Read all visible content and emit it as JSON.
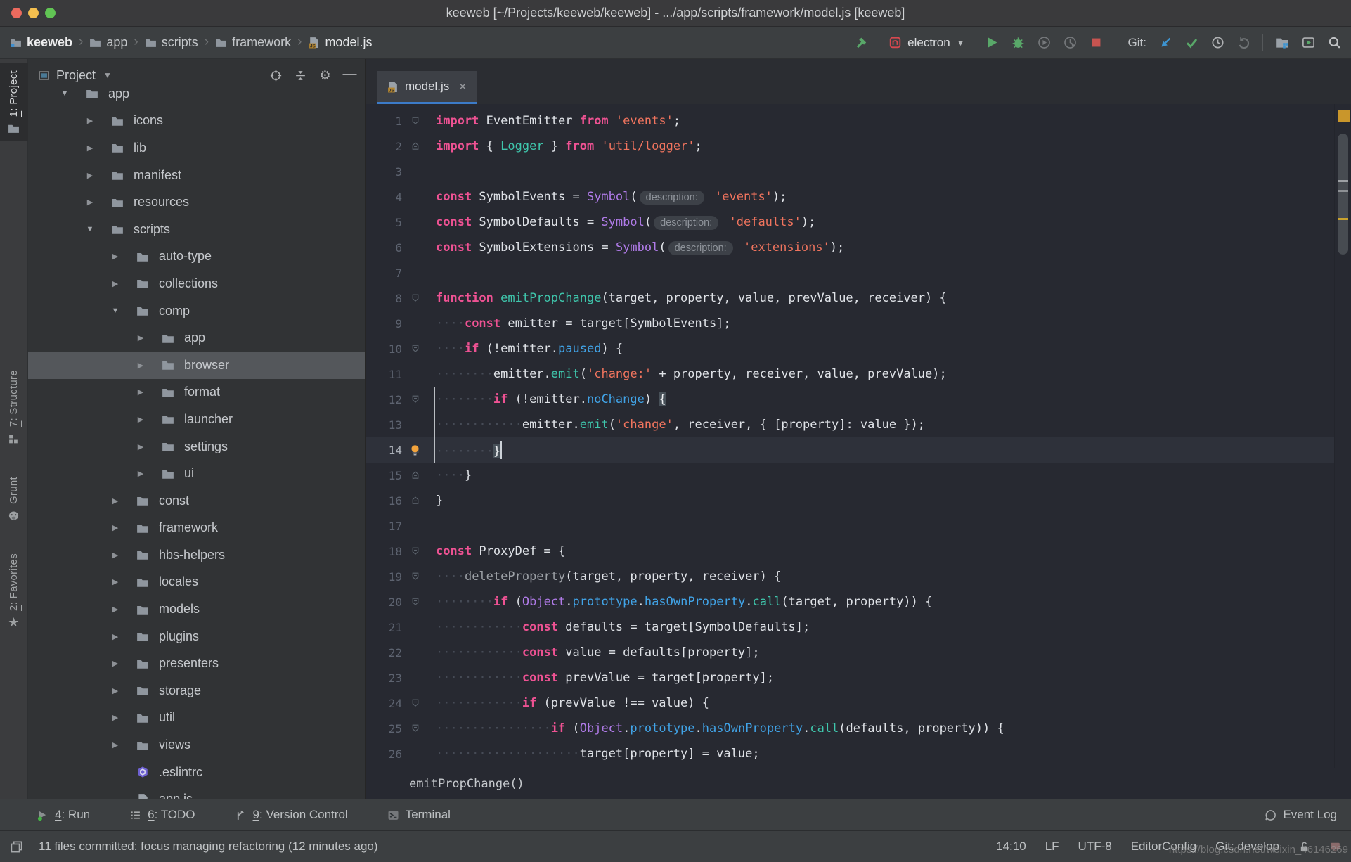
{
  "window": {
    "title": "keeweb [~/Projects/keeweb/keeweb] - .../app/scripts/framework/model.js [keeweb]"
  },
  "breadcrumbs": {
    "items": [
      {
        "label": "keeweb",
        "icon": "project-folder"
      },
      {
        "label": "app",
        "icon": "folder"
      },
      {
        "label": "scripts",
        "icon": "folder"
      },
      {
        "label": "framework",
        "icon": "folder"
      },
      {
        "label": "model.js",
        "icon": "js-file"
      }
    ]
  },
  "toolbar": {
    "run_config": "electron",
    "git_label": "Git:"
  },
  "tool_stripe": {
    "items": [
      {
        "mnemonic": "1",
        "rest": ": Project",
        "icon": "folder",
        "active": true
      },
      {
        "mnemonic": "7",
        "rest": ": Structure",
        "icon": "structure",
        "active": false
      },
      {
        "mnemonic": "",
        "rest": "Grunt",
        "icon": "grunt",
        "active": false
      },
      {
        "mnemonic": "2",
        "rest": ": Favorites",
        "icon": "star",
        "active": false
      }
    ]
  },
  "project_panel": {
    "title": "Project",
    "tree": [
      {
        "label": "app",
        "level": 1,
        "icon": "folder",
        "arrow": "open"
      },
      {
        "label": "icons",
        "level": 2,
        "icon": "folder",
        "arrow": "closed"
      },
      {
        "label": "lib",
        "level": 2,
        "icon": "folder",
        "arrow": "closed"
      },
      {
        "label": "manifest",
        "level": 2,
        "icon": "folder",
        "arrow": "closed"
      },
      {
        "label": "resources",
        "level": 2,
        "icon": "folder",
        "arrow": "closed"
      },
      {
        "label": "scripts",
        "level": 2,
        "icon": "folder",
        "arrow": "open"
      },
      {
        "label": "auto-type",
        "level": 3,
        "icon": "folder",
        "arrow": "closed"
      },
      {
        "label": "collections",
        "level": 3,
        "icon": "folder",
        "arrow": "closed"
      },
      {
        "label": "comp",
        "level": 3,
        "icon": "folder",
        "arrow": "open"
      },
      {
        "label": "app",
        "level": 4,
        "icon": "folder",
        "arrow": "closed"
      },
      {
        "label": "browser",
        "level": 4,
        "icon": "folder",
        "arrow": "closed",
        "selected": true
      },
      {
        "label": "format",
        "level": 4,
        "icon": "folder",
        "arrow": "closed"
      },
      {
        "label": "launcher",
        "level": 4,
        "icon": "folder",
        "arrow": "closed"
      },
      {
        "label": "settings",
        "level": 4,
        "icon": "folder",
        "arrow": "closed"
      },
      {
        "label": "ui",
        "level": 4,
        "icon": "folder",
        "arrow": "closed"
      },
      {
        "label": "const",
        "level": 3,
        "icon": "folder",
        "arrow": "closed"
      },
      {
        "label": "framework",
        "level": 3,
        "icon": "folder",
        "arrow": "closed"
      },
      {
        "label": "hbs-helpers",
        "level": 3,
        "icon": "folder",
        "arrow": "closed"
      },
      {
        "label": "locales",
        "level": 3,
        "icon": "folder",
        "arrow": "closed"
      },
      {
        "label": "models",
        "level": 3,
        "icon": "folder",
        "arrow": "closed"
      },
      {
        "label": "plugins",
        "level": 3,
        "icon": "folder",
        "arrow": "closed"
      },
      {
        "label": "presenters",
        "level": 3,
        "icon": "folder",
        "arrow": "closed"
      },
      {
        "label": "storage",
        "level": 3,
        "icon": "folder",
        "arrow": "closed"
      },
      {
        "label": "util",
        "level": 3,
        "icon": "folder",
        "arrow": "closed"
      },
      {
        "label": "views",
        "level": 3,
        "icon": "folder",
        "arrow": "closed"
      },
      {
        "label": ".eslintrc",
        "level": 3,
        "icon": "eslint",
        "arrow": "none"
      },
      {
        "label": "app.js",
        "level": 3,
        "icon": "js-file",
        "arrow": "none"
      }
    ]
  },
  "editor": {
    "tab_label": "model.js",
    "breadcrumb": "emitPropChange()",
    "lines": [
      {
        "f": "d",
        "t": [
          [
            "kw",
            "import"
          ],
          [
            "txt",
            " EventEmitter "
          ],
          [
            "kw",
            "from"
          ],
          [
            "txt",
            " "
          ],
          [
            "str",
            "'events'"
          ],
          [
            "txt",
            ";"
          ]
        ]
      },
      {
        "f": "u",
        "t": [
          [
            "kw",
            "import"
          ],
          [
            "txt",
            " { "
          ],
          [
            "fn",
            "Logger"
          ],
          [
            "txt",
            " } "
          ],
          [
            "kw",
            "from"
          ],
          [
            "txt",
            " "
          ],
          [
            "str",
            "'util/logger'"
          ],
          [
            "txt",
            ";"
          ]
        ]
      },
      {
        "t": []
      },
      {
        "t": [
          [
            "kw",
            "const"
          ],
          [
            "txt",
            " SymbolEvents = "
          ],
          [
            "cls",
            "Symbol"
          ],
          [
            "txt",
            "("
          ],
          [
            "hint",
            "description:"
          ],
          [
            "txt",
            " "
          ],
          [
            "str",
            "'events'"
          ],
          [
            "txt",
            ");"
          ]
        ]
      },
      {
        "t": [
          [
            "kw",
            "const"
          ],
          [
            "txt",
            " SymbolDefaults = "
          ],
          [
            "cls",
            "Symbol"
          ],
          [
            "txt",
            "("
          ],
          [
            "hint",
            "description:"
          ],
          [
            "txt",
            " "
          ],
          [
            "str",
            "'defaults'"
          ],
          [
            "txt",
            ");"
          ]
        ]
      },
      {
        "t": [
          [
            "kw",
            "const"
          ],
          [
            "txt",
            " SymbolExtensions = "
          ],
          [
            "cls",
            "Symbol"
          ],
          [
            "txt",
            "("
          ],
          [
            "hint",
            "description:"
          ],
          [
            "txt",
            " "
          ],
          [
            "str",
            "'extensions'"
          ],
          [
            "txt",
            ");"
          ]
        ]
      },
      {
        "t": []
      },
      {
        "f": "d",
        "t": [
          [
            "kw",
            "function"
          ],
          [
            "txt",
            " "
          ],
          [
            "fn",
            "emitPropChange"
          ],
          [
            "txt",
            "(target, property, value, prevValue, receiver) {"
          ]
        ]
      },
      {
        "t": [
          [
            "ws",
            "····"
          ],
          [
            "kw",
            "const"
          ],
          [
            "txt",
            " emitter = target[SymbolEvents];"
          ]
        ]
      },
      {
        "f": "d",
        "t": [
          [
            "ws",
            "····"
          ],
          [
            "kw",
            "if"
          ],
          [
            "txt",
            " (!emitter."
          ],
          [
            "prop",
            "paused"
          ],
          [
            "txt",
            ") {"
          ]
        ]
      },
      {
        "t": [
          [
            "ws",
            "········"
          ],
          [
            "txt",
            "emitter."
          ],
          [
            "fn",
            "emit"
          ],
          [
            "txt",
            "("
          ],
          [
            "str",
            "'change:'"
          ],
          [
            "txt",
            " + property, receiver, value, prevValue);"
          ]
        ]
      },
      {
        "f": "d",
        "c": true,
        "t": [
          [
            "ws",
            "········"
          ],
          [
            "kw",
            "if"
          ],
          [
            "txt",
            " (!emitter."
          ],
          [
            "prop",
            "noChange"
          ],
          [
            "txt",
            ") "
          ],
          [
            "match",
            "{"
          ]
        ]
      },
      {
        "c": true,
        "t": [
          [
            "ws",
            "············"
          ],
          [
            "txt",
            "emitter."
          ],
          [
            "fn",
            "emit"
          ],
          [
            "txt",
            "("
          ],
          [
            "str",
            "'change'"
          ],
          [
            "txt",
            ", receiver, { [property]: value });"
          ]
        ]
      },
      {
        "f": "u",
        "c": true,
        "cur": true,
        "bulb": true,
        "t": [
          [
            "ws",
            "········"
          ],
          [
            "match",
            "}"
          ],
          [
            "caret",
            ""
          ]
        ]
      },
      {
        "f": "u",
        "t": [
          [
            "ws",
            "····"
          ],
          [
            "txt",
            "}"
          ]
        ]
      },
      {
        "f": "u",
        "t": [
          [
            "txt",
            "}"
          ]
        ]
      },
      {
        "t": []
      },
      {
        "f": "d",
        "t": [
          [
            "kw",
            "const"
          ],
          [
            "txt",
            " ProxyDef = {"
          ]
        ]
      },
      {
        "f": "d",
        "t": [
          [
            "ws",
            "····"
          ],
          [
            "gfn",
            "deleteProperty"
          ],
          [
            "txt",
            "(target, property, receiver) {"
          ]
        ]
      },
      {
        "f": "d",
        "t": [
          [
            "ws",
            "········"
          ],
          [
            "kw",
            "if"
          ],
          [
            "txt",
            " ("
          ],
          [
            "cls",
            "Object"
          ],
          [
            "txt",
            "."
          ],
          [
            "prop",
            "prototype"
          ],
          [
            "txt",
            "."
          ],
          [
            "prop",
            "hasOwnProperty"
          ],
          [
            "txt",
            "."
          ],
          [
            "fn",
            "call"
          ],
          [
            "txt",
            "(target, property)) {"
          ]
        ]
      },
      {
        "t": [
          [
            "ws",
            "············"
          ],
          [
            "kw",
            "const"
          ],
          [
            "txt",
            " defaults = target[SymbolDefaults];"
          ]
        ]
      },
      {
        "t": [
          [
            "ws",
            "············"
          ],
          [
            "kw",
            "const"
          ],
          [
            "txt",
            " value = defaults[property];"
          ]
        ]
      },
      {
        "t": [
          [
            "ws",
            "············"
          ],
          [
            "kw",
            "const"
          ],
          [
            "txt",
            " prevValue = target[property];"
          ]
        ]
      },
      {
        "f": "d",
        "t": [
          [
            "ws",
            "············"
          ],
          [
            "kw",
            "if"
          ],
          [
            "txt",
            " (prevValue !== value) {"
          ]
        ]
      },
      {
        "f": "d",
        "t": [
          [
            "ws",
            "················"
          ],
          [
            "kw",
            "if"
          ],
          [
            "txt",
            " ("
          ],
          [
            "cls",
            "Object"
          ],
          [
            "txt",
            "."
          ],
          [
            "prop",
            "prototype"
          ],
          [
            "txt",
            "."
          ],
          [
            "prop",
            "hasOwnProperty"
          ],
          [
            "txt",
            "."
          ],
          [
            "fn",
            "call"
          ],
          [
            "txt",
            "(defaults, property)) {"
          ]
        ]
      },
      {
        "t": [
          [
            "ws",
            "····················"
          ],
          [
            "txt",
            "target[property] = value;"
          ]
        ]
      }
    ]
  },
  "bottom_bar": {
    "items": [
      {
        "mnemonic": "4",
        "rest": ": Run",
        "icon": "run-gray"
      },
      {
        "mnemonic": "6",
        "rest": ": TODO",
        "icon": "list"
      },
      {
        "mnemonic": "9",
        "rest": ": Version Control",
        "icon": "vcs"
      },
      {
        "mnemonic": "",
        "rest": "Terminal",
        "icon": "terminal"
      }
    ],
    "right_label": "Event Log"
  },
  "status_bar": {
    "message": "11 files committed: focus managing refactoring (12 minutes ago)",
    "time": "14:10",
    "line_ending": "LF",
    "encoding": "UTF-8",
    "editorconfig": "EditorConfig",
    "git_branch": "Git: develop"
  },
  "watermark": "https://blog.csdn.net/weixin_46146269",
  "colors": {
    "tab_underline": "#3c7bc8",
    "keyword": "#ee5293",
    "string": "#f0745e",
    "function": "#3fc6ac",
    "class": "#b07be8",
    "property": "#41a4e8",
    "run_green": "#59a869",
    "stop_red": "#c75450",
    "update_blue": "#3d94d0",
    "warning_stripe": "#c9962b",
    "selection_bg": "#54575b"
  }
}
